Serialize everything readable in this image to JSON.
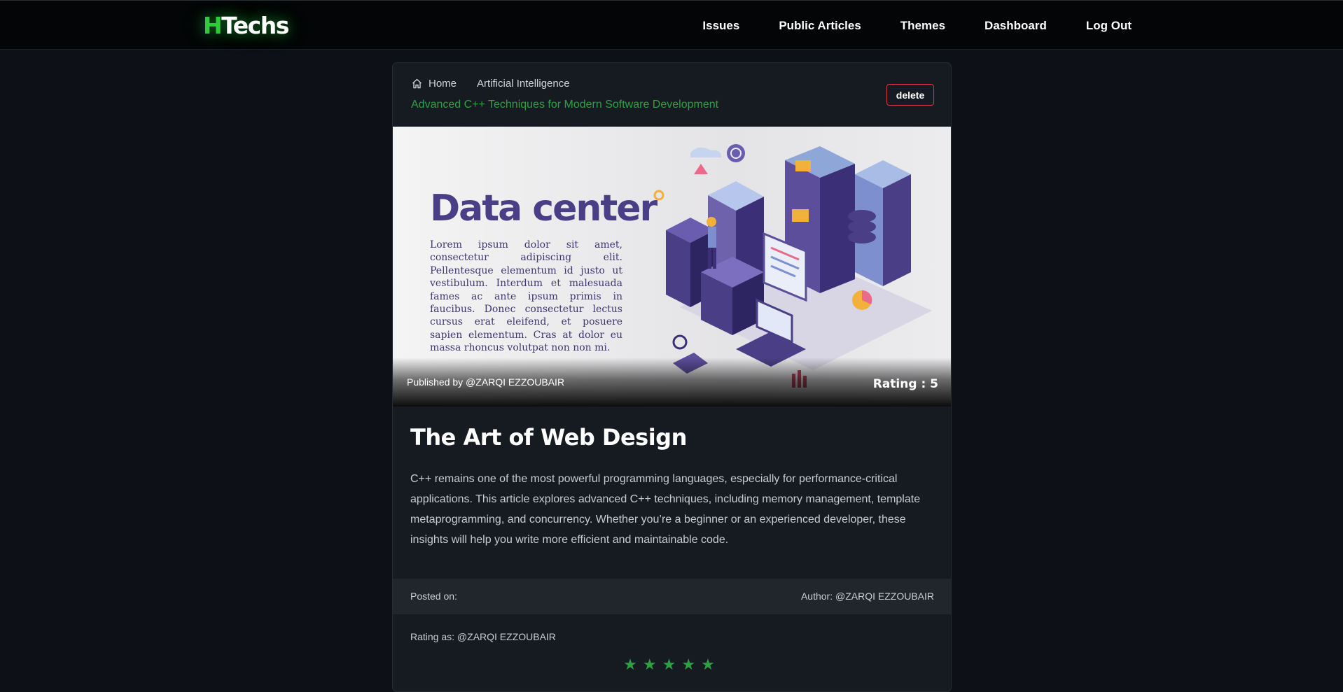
{
  "nav": {
    "logo_h": "H",
    "logo_rest": "Techs",
    "links": [
      "Issues",
      "Public Articles",
      "Themes",
      "Dashboard",
      "Log Out"
    ]
  },
  "breadcrumb": {
    "home": "Home",
    "category": "Artificial Intelligence",
    "current": "Advanced C++ Techniques for Modern Software Development"
  },
  "actions": {
    "delete_label": "delete"
  },
  "hero": {
    "image_title": "Data center",
    "image_text": "Lorem ipsum dolor sit amet, consectetur adipiscing elit. Pellentesque elementum id justo ut vestibulum. Interdum et malesuada fames ac ante ipsum primis in faucibus. Donec consectetur lectus cursus erat eleifend, et posuere sapien elementum. Cras at dolor eu massa rhoncus volutpat non non mi.",
    "published_by": "Published by @ZARQI EZZOUBAIR",
    "rating": "Rating : 5"
  },
  "article": {
    "title": "The Art of Web Design",
    "body": "C++ remains one of the most powerful programming languages, especially for performance-critical applications. This article explores advanced C++ techniques, including memory management, template metaprogramming, and concurrency. Whether you’re a beginner or an experienced developer, these insights will help you write more efficient and maintainable code."
  },
  "meta": {
    "posted_on": "Posted on:",
    "author": "Author: @ZARQI EZZOUBAIR",
    "rating_as": "Rating as: @ZARQI EZZOUBAIR"
  },
  "rating_stars": {
    "value": 5,
    "max": 5,
    "glyph": "★"
  },
  "colors": {
    "accent_green": "#2ea043",
    "background": "#0d1117",
    "card": "#161b22",
    "delete_border": "#d9363e"
  },
  "icons": [
    "home-icon",
    "star-icon"
  ]
}
